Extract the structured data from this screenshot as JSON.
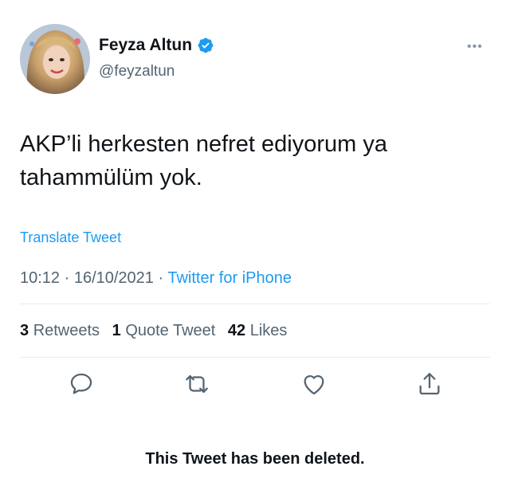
{
  "tweet": {
    "author": {
      "display_name": "Feyza Altun",
      "handle": "@feyzaltun",
      "verified_icon": "verified-badge-icon"
    },
    "more_icon": "more-options-icon",
    "text_line1": "AKP’li herkesten nefret ediyorum ya",
    "text_line2": "tahammülüm yok.",
    "translate_label": "Translate Tweet",
    "timestamp": "10:12 · 16/10/2021",
    "separator": " · ",
    "source": "Twitter for iPhone",
    "stats": {
      "retweets_count": "3",
      "retweets_label": "Retweets",
      "quotes_count": "1",
      "quotes_label": "Quote Tweet",
      "likes_count": "42",
      "likes_label": "Likes"
    },
    "actions": [
      "reply-icon",
      "retweet-icon",
      "like-icon",
      "share-icon"
    ]
  },
  "notice": "This Tweet has been deleted.",
  "colors": {
    "accent": "#1d9bf0",
    "text": "#0f1419",
    "muted": "#536471",
    "divider": "#e6ecf0"
  }
}
